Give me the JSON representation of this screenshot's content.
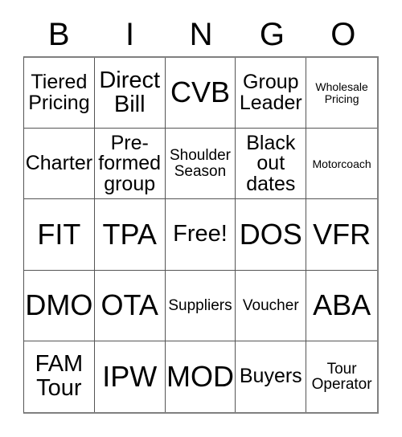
{
  "card": {
    "title_letters": [
      "B",
      "I",
      "N",
      "G",
      "O"
    ],
    "rows": [
      [
        {
          "text": "Tiered\nPricing",
          "size": "md"
        },
        {
          "text": "Direct\nBill",
          "size": "lg"
        },
        {
          "text": "CVB",
          "size": "xl"
        },
        {
          "text": "Group\nLeader",
          "size": "md"
        },
        {
          "text": "Wholesale\nPricing",
          "size": "xs"
        }
      ],
      [
        {
          "text": "Charter",
          "size": "md"
        },
        {
          "text": "Pre-\nformed\ngroup",
          "size": "md"
        },
        {
          "text": "Shoulder\nSeason",
          "size": "sm"
        },
        {
          "text": "Black\nout\ndates",
          "size": "md"
        },
        {
          "text": "Motorcoach",
          "size": "xs"
        }
      ],
      [
        {
          "text": "FIT",
          "size": "xl"
        },
        {
          "text": "TPA",
          "size": "xl"
        },
        {
          "text": "Free!",
          "size": "lg"
        },
        {
          "text": "DOS",
          "size": "xl"
        },
        {
          "text": "VFR",
          "size": "xl"
        }
      ],
      [
        {
          "text": "DMO",
          "size": "xl"
        },
        {
          "text": "OTA",
          "size": "xl"
        },
        {
          "text": "Suppliers",
          "size": "sm"
        },
        {
          "text": "Voucher",
          "size": "sm"
        },
        {
          "text": "ABA",
          "size": "xl"
        }
      ],
      [
        {
          "text": "FAM\nTour",
          "size": "lg"
        },
        {
          "text": "IPW",
          "size": "xl"
        },
        {
          "text": "MOD",
          "size": "xl"
        },
        {
          "text": "Buyers",
          "size": "md"
        },
        {
          "text": "Tour\nOperator",
          "size": "sm"
        }
      ]
    ],
    "free_space": "Free!",
    "colors": {
      "background": "#ffffff",
      "text": "#000000",
      "grid_line": "#555555",
      "grid_outer": "#808080"
    }
  }
}
